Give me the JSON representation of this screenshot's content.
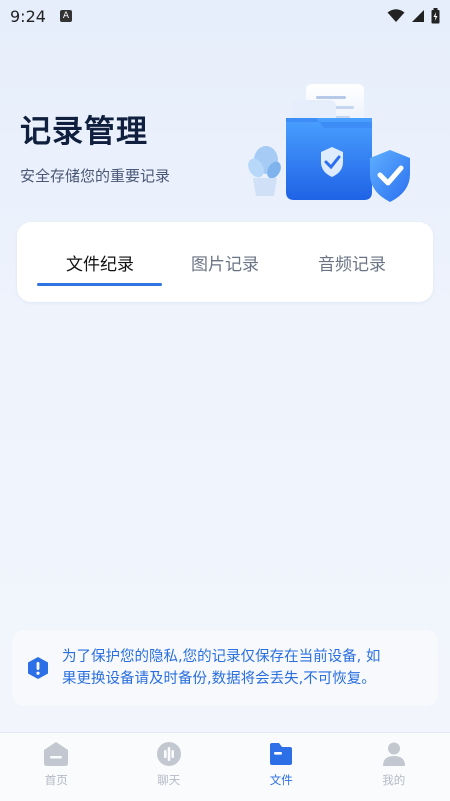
{
  "status": {
    "time": "9:24",
    "badge": "A"
  },
  "header": {
    "title": "记录管理",
    "subtitle": "安全存储您的重要记录"
  },
  "tabs": [
    {
      "label": "文件纪录",
      "active": true
    },
    {
      "label": "图片记录",
      "active": false
    },
    {
      "label": "音频记录",
      "active": false
    }
  ],
  "notice": {
    "line1": "为了保护您的隐私,您的记录仅保存在当前设备, 如",
    "line2": "果更换设备请及时备份,数据将会丢失,不可恢复。",
    "icon": "exclamation-shield-icon"
  },
  "nav": [
    {
      "label": "首页",
      "icon": "home-icon",
      "active": false
    },
    {
      "label": "聊天",
      "icon": "chat-icon",
      "active": false
    },
    {
      "label": "文件",
      "icon": "folder-icon",
      "active": true
    },
    {
      "label": "我的",
      "icon": "profile-icon",
      "active": false
    }
  ],
  "colors": {
    "accent": "#2c6fe6",
    "background": "#eef3fc",
    "title": "#0f1f3d"
  }
}
